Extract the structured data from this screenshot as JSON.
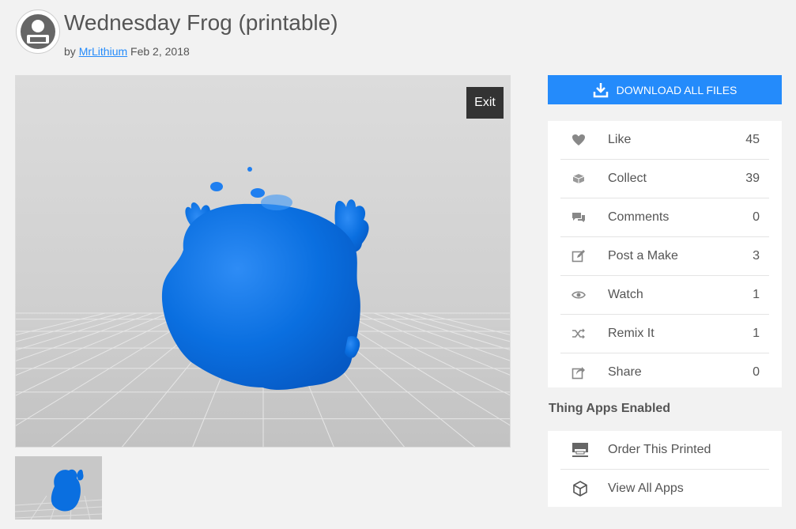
{
  "thing": {
    "title": "Wednesday Frog (printable)",
    "by_label": "by",
    "author": "MrLithium",
    "date": "Feb 2, 2018"
  },
  "viewer": {
    "exit_label": "Exit",
    "model_color": "#0a6fe0"
  },
  "download": {
    "label": "DOWNLOAD ALL FILES",
    "icon": "download-icon",
    "color": "#248bfb"
  },
  "stats": [
    {
      "icon": "heart-icon",
      "label": "Like",
      "count": "45"
    },
    {
      "icon": "collect-icon",
      "label": "Collect",
      "count": "39"
    },
    {
      "icon": "comments-icon",
      "label": "Comments",
      "count": "0"
    },
    {
      "icon": "post-make-icon",
      "label": "Post a Make",
      "count": "3"
    },
    {
      "icon": "eye-icon",
      "label": "Watch",
      "count": "1"
    },
    {
      "icon": "shuffle-icon",
      "label": "Remix It",
      "count": "1"
    },
    {
      "icon": "share-icon",
      "label": "Share",
      "count": "0"
    }
  ],
  "apps": {
    "title": "Thing Apps Enabled",
    "items": [
      {
        "icon": "printer-icon",
        "label": "Order This Printed"
      },
      {
        "icon": "cube-icon",
        "label": "View All Apps"
      }
    ]
  }
}
